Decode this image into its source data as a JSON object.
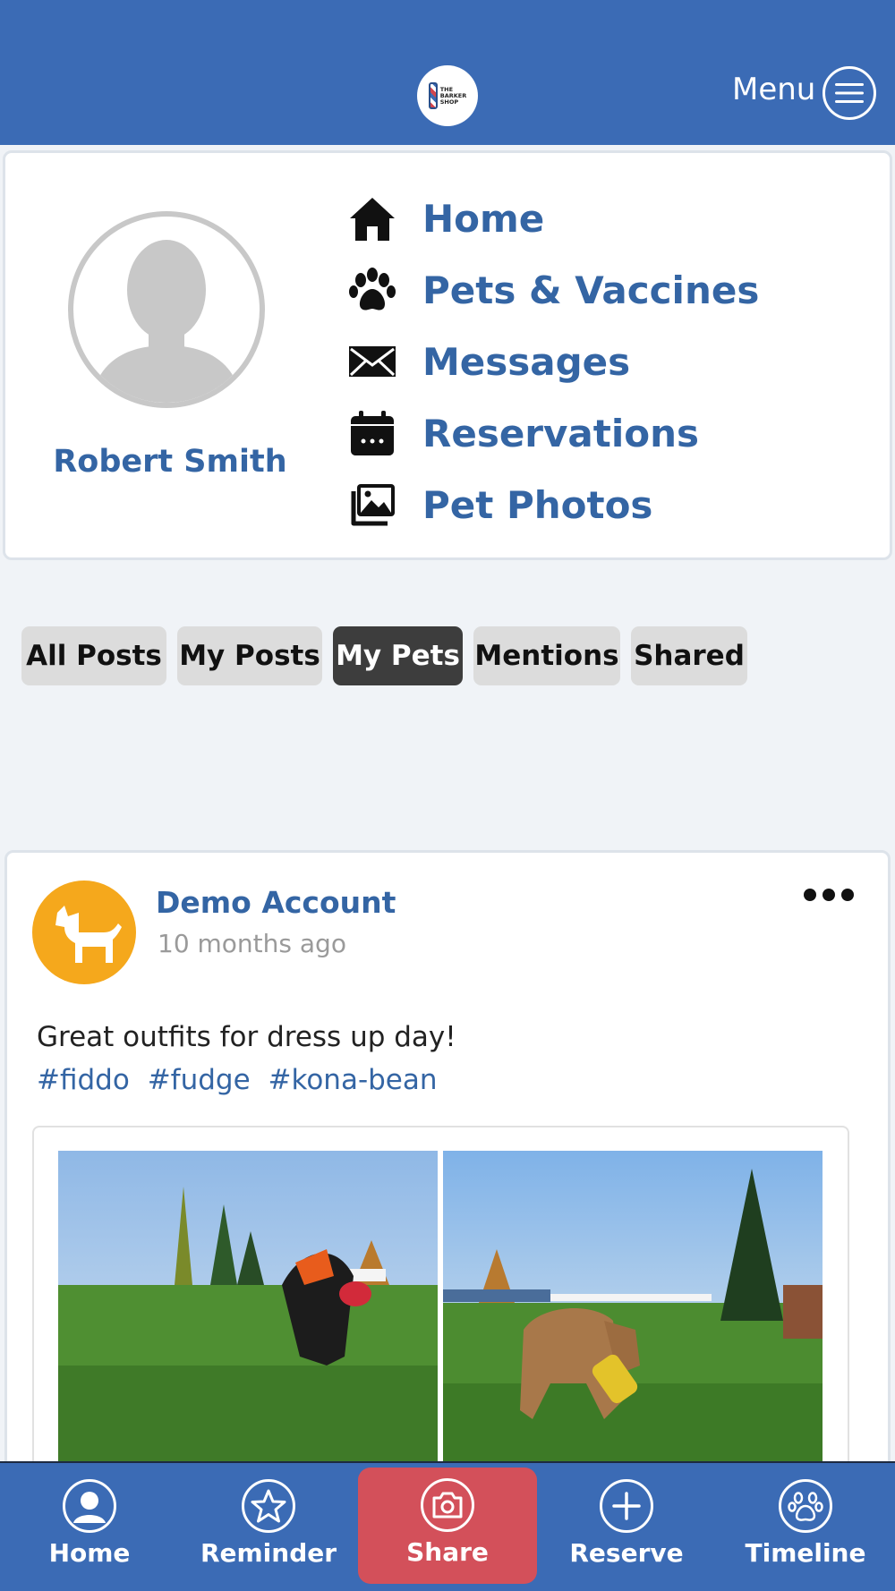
{
  "header": {
    "logo_text": [
      "THE",
      "BARKER",
      "SHOP"
    ],
    "menu_label": "Menu",
    "colors": {
      "bar": "#3b6bb5"
    }
  },
  "profile": {
    "name": "Robert Smith",
    "nav": [
      {
        "label": "Home",
        "icon": "house-icon"
      },
      {
        "label": "Pets & Vaccines",
        "icon": "paw-icon"
      },
      {
        "label": "Messages",
        "icon": "envelope-icon"
      },
      {
        "label": "Reservations",
        "icon": "calendar-icon"
      },
      {
        "label": "Pet Photos",
        "icon": "photos-icon"
      }
    ]
  },
  "tabs": [
    {
      "label": "All Posts",
      "active": false
    },
    {
      "label": "My Posts",
      "active": false
    },
    {
      "label": "My Pets",
      "active": true
    },
    {
      "label": "Mentions",
      "active": false
    },
    {
      "label": "Shared",
      "active": false
    }
  ],
  "post": {
    "author": "Demo Account",
    "time": "10 months ago",
    "text": "Great outfits for dress up day!",
    "tags": [
      "#fiddo",
      "#fudge",
      "#kona-bean"
    ],
    "avatar_color": "#f5a81c"
  },
  "bottom_nav": [
    {
      "label": "Home",
      "icon": "user-circle-icon"
    },
    {
      "label": "Reminder",
      "icon": "star-icon"
    },
    {
      "label": "Share",
      "icon": "camera-icon",
      "highlight_color": "#d3505a"
    },
    {
      "label": "Reserve",
      "icon": "plus-icon"
    },
    {
      "label": "Timeline",
      "icon": "paw-icon"
    }
  ]
}
